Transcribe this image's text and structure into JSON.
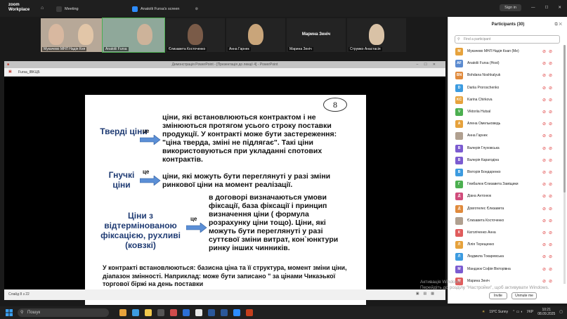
{
  "titlebar": {
    "logo_line1": "zoom",
    "logo_line2": "Workplace",
    "tab_meeting": "Meeting",
    "tab_screen": "Anatolii Fursa's screen",
    "sign_in": "Sign in"
  },
  "video": {
    "tiles": [
      {
        "name": "Мукачево МНЛ Надія Кня"
      },
      {
        "name": "Anatolii Fursa"
      },
      {
        "name": "Єлизавета Косточенко"
      },
      {
        "name": "Анна Гарнек"
      },
      {
        "name": "Марина Зеніч"
      },
      {
        "name": "Струмко Анастасія"
      }
    ],
    "big_name": "Марина Зеніч"
  },
  "ppt": {
    "window_title": "Демонстрація PowerPoint - [Презентація до лекції 4] - PowerPoint",
    "tab": "Fursa_IBKЦБ",
    "status": "Слайд 8 з 22"
  },
  "slide": {
    "number": "8",
    "rows": [
      {
        "category": "Тверді ціни",
        "connector": "це",
        "text": "ціни, які встановлюються контрактом і не змінюються протягом усього строку поставки продукції. У контракті може бути застереження: \"ціна тверда, зміні не підлягає\". Такі ціни використовуються при укладанні спотових контрактів."
      },
      {
        "category": "Гнучкі ціни",
        "connector": "це",
        "text": "ціни, які можуть бути переглянуті у разі зміни ринкової ціни на момент реалізації."
      },
      {
        "category": "Ціни з відтермінованою фіксацією, рухливі (ковзкі)",
        "connector": "це",
        "text": "в договорі визначаються умови фіксації, база фіксації і принцип визначення ціни ( формула розрахунку ціни тощо). Ціни, які можуть бути переглянуті у разі суттєвої зміни витрат, кон`юнктури ринку інших чинників."
      }
    ],
    "footer": "У контракті встановлюються: базисна ціна та її структура, момент зміни ціни, діапазон змінності. Наприклад: може бути записано \" за цінами Чикаэької торгової біржі на день поставки"
  },
  "participants": {
    "title": "Participants (30)",
    "search_placeholder": "Find a participant",
    "list": [
      {
        "initials": "М",
        "name": "Мукачево МНЛ Надія Кнап (Me)",
        "color": "#e6a23c"
      },
      {
        "initials": "AF",
        "name": "Anatolii Fursa (Host)",
        "color": "#5b8bd0"
      },
      {
        "initials": "BN",
        "name": "Bohdana Noshkalyuk",
        "color": "#e08a3c"
      },
      {
        "initials": "D",
        "name": "Dariia Proroschenko",
        "color": "#3c9be0"
      },
      {
        "initials": "KC",
        "name": "Karina Chirkova",
        "color": "#e6a23c"
      },
      {
        "initials": "V",
        "name": "Viktoriia Hutsal",
        "color": "#4caf50"
      },
      {
        "initials": "А",
        "name": "Алена Омельковедь",
        "color": "#e6a23c"
      },
      {
        "initials": "",
        "name": "Анна Гарнек",
        "color": "#b0a090"
      },
      {
        "initials": "В",
        "name": "Валерія Глуховська",
        "color": "#7b5bd0"
      },
      {
        "initials": "В",
        "name": "Валерія Карагодіна",
        "color": "#7b5bd0"
      },
      {
        "initials": "В",
        "name": "Вікторія Бондаренко",
        "color": "#3c9be0"
      },
      {
        "initials": "Г",
        "name": "Гембалюк Єлизавета Заміщики",
        "color": "#4caf50"
      },
      {
        "initials": "Д",
        "name": "Діана Антонюк",
        "color": "#d04c7b"
      },
      {
        "initials": "Д",
        "name": "Довготелес Єлизавета",
        "color": "#e08a3c"
      },
      {
        "initials": "",
        "name": "Єлизавета Косточенко",
        "color": "#b0a090"
      },
      {
        "initials": "К",
        "name": "Католіченко Анна",
        "color": "#e05c5c"
      },
      {
        "initials": "Л",
        "name": "Лілія Терещенко",
        "color": "#e6a23c"
      },
      {
        "initials": "Л",
        "name": "Людмила Токаревська",
        "color": "#3c9be0"
      },
      {
        "initials": "М",
        "name": "Мандзюк Софія Вікторівна",
        "color": "#7b5bd0"
      },
      {
        "initials": "М",
        "name": "Марина Зеніч",
        "color": "#e05c5c"
      }
    ],
    "invite": "Invite",
    "unmute_me": "Unmute me"
  },
  "watermark": {
    "line1": "Активація Windows",
    "line2": "Перейдіть до розділу \"Настройки\", щоб активувати Windows."
  },
  "taskbar": {
    "search": "Пошук",
    "weather": "19°C  Sunny",
    "lang": "УКР",
    "time": "10:21",
    "date": "08.09.2025"
  }
}
